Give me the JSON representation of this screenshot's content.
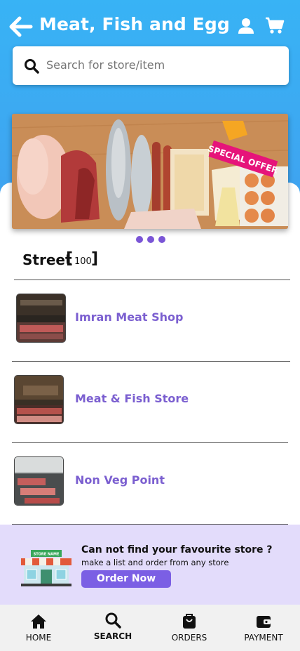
{
  "header": {
    "title": "Meat, Fish and Egg",
    "back_icon": "arrow-left-icon",
    "user_icon": "user-icon",
    "cart_icon": "cart-icon"
  },
  "search": {
    "placeholder": "Search for store/item",
    "icon": "search-icon"
  },
  "banner": {
    "badge": "SPECIAL OFFER",
    "slides_indicator_count": 3
  },
  "street": {
    "label": "Street",
    "count": "100"
  },
  "stores": [
    {
      "name": "Imran Meat Shop"
    },
    {
      "name": "Meat & Fish Store"
    },
    {
      "name": "Non Veg Point"
    }
  ],
  "promo": {
    "title": "Can not find your favourite store ?",
    "subtitle": "make a list and order from any store",
    "button": "Order Now",
    "sign": "STORE NAME"
  },
  "nav": [
    {
      "label": "HOME",
      "icon": "home-icon"
    },
    {
      "label": "SEARCH",
      "icon": "search-icon",
      "active": true
    },
    {
      "label": "ORDERS",
      "icon": "shopping-bag-icon"
    },
    {
      "label": "PAYMENT",
      "icon": "wallet-icon"
    }
  ],
  "colors": {
    "header_bg": "#3fa3f0",
    "accent": "#7b5fd0",
    "promo_bg": "#e3dcfb",
    "button": "#7b5fe4"
  }
}
